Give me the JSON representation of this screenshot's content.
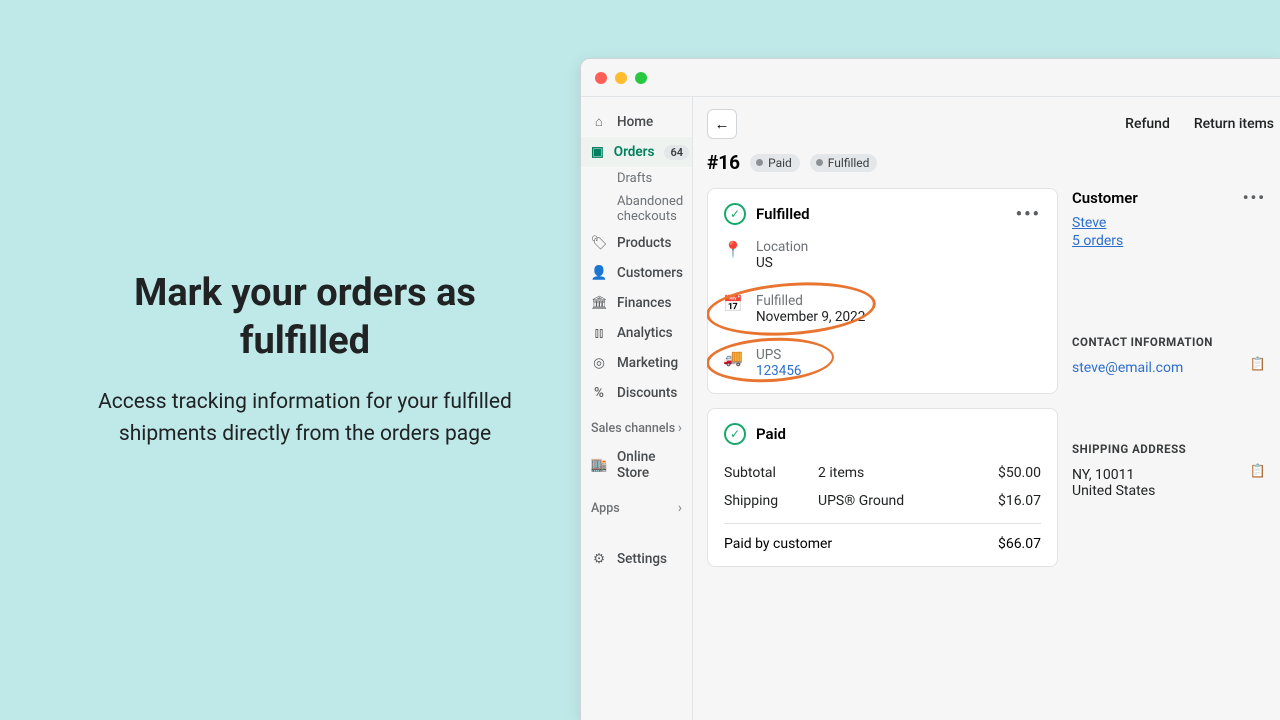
{
  "marketing": {
    "headline": "Mark your orders as fulfilled",
    "sub": "Access tracking information for your fulfilled shipments directly from the orders page"
  },
  "sidebar": {
    "home": "Home",
    "orders": "Orders",
    "orders_badge": "64",
    "drafts": "Drafts",
    "abandoned": "Abandoned checkouts",
    "products": "Products",
    "customers": "Customers",
    "finances": "Finances",
    "analytics": "Analytics",
    "marketing": "Marketing",
    "discounts": "Discounts",
    "sales_channels": "Sales channels",
    "online_store": "Online Store",
    "apps": "Apps",
    "settings": "Settings"
  },
  "top": {
    "refund": "Refund",
    "return": "Return items"
  },
  "order": {
    "number": "#16",
    "paid_pill": "Paid",
    "fulfilled_pill": "Fulfilled"
  },
  "fulfilled": {
    "title": "Fulfilled",
    "location_label": "Location",
    "location_value": "US",
    "fulfilled_label": "Fulfilled",
    "fulfilled_value": "November 9, 2022",
    "carrier_label": "UPS",
    "tracking": "123456"
  },
  "paid": {
    "title": "Paid",
    "subtotal_label": "Subtotal",
    "subtotal_qty": "2 items",
    "subtotal_amt": "$50.00",
    "shipping_label": "Shipping",
    "shipping_method": "UPS® Ground",
    "shipping_amt": "$16.07",
    "paid_by": "Paid by customer",
    "total": "$66.07"
  },
  "customer": {
    "title": "Customer",
    "name": "Steve",
    "orders": "5 orders",
    "contact_label": "CONTACT INFORMATION",
    "email": "steve@email.com",
    "shipping_label": "SHIPPING ADDRESS",
    "addr1": "NY, 10011",
    "addr2": "United States"
  }
}
